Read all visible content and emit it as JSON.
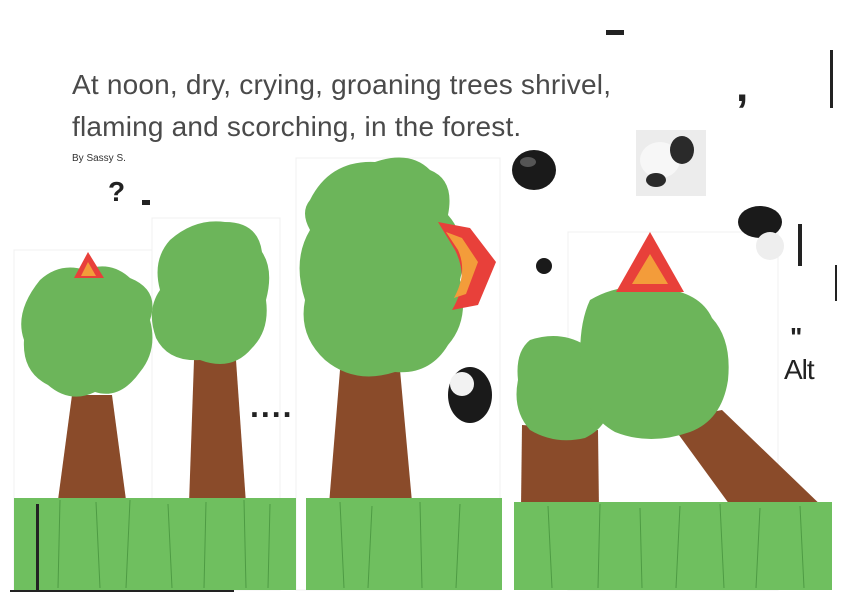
{
  "title": {
    "line1": "At noon, dry, crying, groaning trees shrivel,",
    "line2": "flaming and scorching, in the forest."
  },
  "byline": "By Sassy S.",
  "stray_marks": {
    "dots": "....",
    "alt": "Alt",
    "quote": "\"",
    "comma": ",",
    "question": "?",
    "dash": "–"
  },
  "colors": {
    "tree_green": "#6cb55a",
    "tree_green_dark": "#5aa748",
    "trunk_brown": "#8a4b2a",
    "grass_green": "#6fbf5f",
    "flame_red": "#e8403a",
    "flame_orange": "#f39c3a",
    "smoke_black": "#1a1a1a"
  },
  "icons": [
    "fire-flame-icon",
    "smoke-tissue-icon",
    "tree-icon"
  ]
}
